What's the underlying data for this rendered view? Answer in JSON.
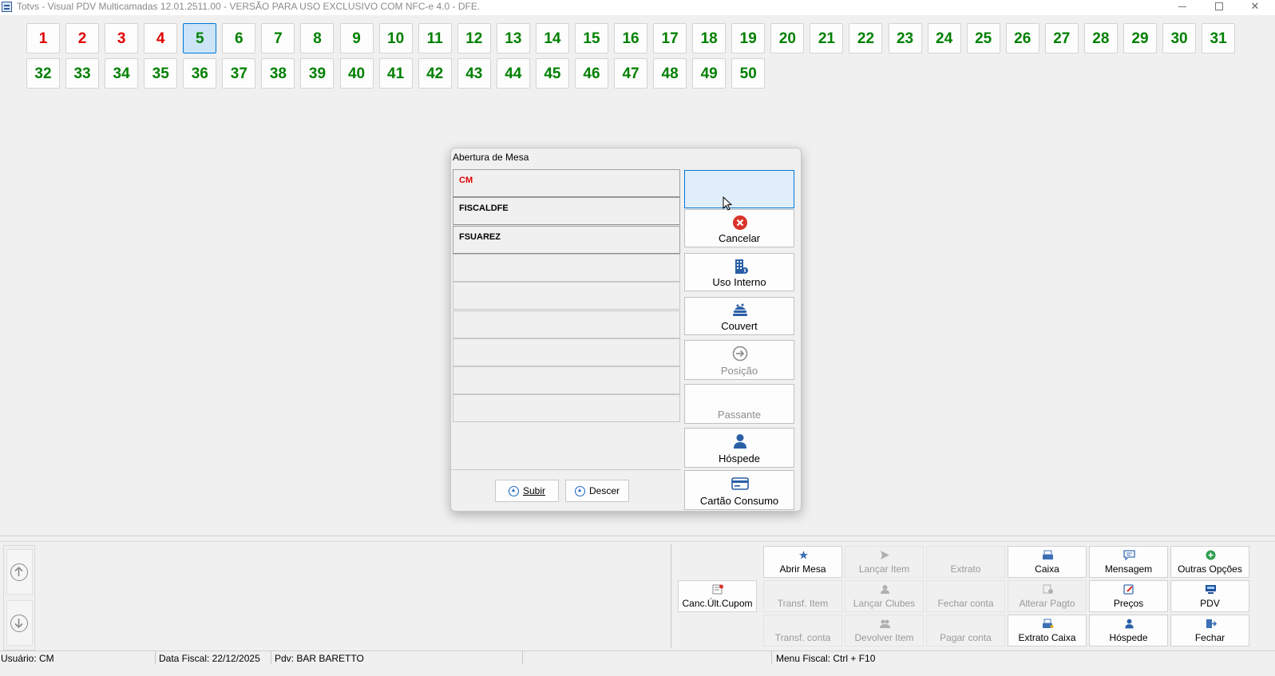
{
  "window": {
    "title": "Totvs - Visual PDV Multicamadas 12.01.2511.00 - VERSÃO PARA USO EXCLUSIVO COM NFC-e 4.0 - DFE."
  },
  "tables": [
    {
      "n": "1",
      "color": "red"
    },
    {
      "n": "2",
      "color": "red"
    },
    {
      "n": "3",
      "color": "red"
    },
    {
      "n": "4",
      "color": "red"
    },
    {
      "n": "5",
      "color": "green",
      "selected": true
    },
    {
      "n": "6",
      "color": "green"
    },
    {
      "n": "7",
      "color": "green"
    },
    {
      "n": "8",
      "color": "green"
    },
    {
      "n": "9",
      "color": "green"
    },
    {
      "n": "10",
      "color": "green"
    },
    {
      "n": "11",
      "color": "green"
    },
    {
      "n": "12",
      "color": "green"
    },
    {
      "n": "13",
      "color": "green"
    },
    {
      "n": "14",
      "color": "green"
    },
    {
      "n": "15",
      "color": "green"
    },
    {
      "n": "16",
      "color": "green"
    },
    {
      "n": "17",
      "color": "green"
    },
    {
      "n": "18",
      "color": "green"
    },
    {
      "n": "19",
      "color": "green"
    },
    {
      "n": "20",
      "color": "green"
    },
    {
      "n": "21",
      "color": "green"
    },
    {
      "n": "22",
      "color": "green"
    },
    {
      "n": "23",
      "color": "green"
    },
    {
      "n": "24",
      "color": "green"
    },
    {
      "n": "25",
      "color": "green"
    },
    {
      "n": "26",
      "color": "green"
    },
    {
      "n": "27",
      "color": "green"
    },
    {
      "n": "28",
      "color": "green"
    },
    {
      "n": "29",
      "color": "green"
    },
    {
      "n": "30",
      "color": "green"
    },
    {
      "n": "31",
      "color": "green"
    },
    {
      "n": "32",
      "color": "green"
    },
    {
      "n": "33",
      "color": "green"
    },
    {
      "n": "34",
      "color": "green"
    },
    {
      "n": "35",
      "color": "green"
    },
    {
      "n": "36",
      "color": "green"
    },
    {
      "n": "37",
      "color": "green"
    },
    {
      "n": "38",
      "color": "green"
    },
    {
      "n": "39",
      "color": "green"
    },
    {
      "n": "40",
      "color": "green"
    },
    {
      "n": "41",
      "color": "green"
    },
    {
      "n": "42",
      "color": "green"
    },
    {
      "n": "43",
      "color": "green"
    },
    {
      "n": "44",
      "color": "green"
    },
    {
      "n": "45",
      "color": "green"
    },
    {
      "n": "46",
      "color": "green"
    },
    {
      "n": "47",
      "color": "green"
    },
    {
      "n": "48",
      "color": "green"
    },
    {
      "n": "49",
      "color": "green"
    },
    {
      "n": "50",
      "color": "green"
    }
  ],
  "dialog": {
    "title": "Abertura de Mesa",
    "users": [
      "CM",
      "FISCALDFE",
      "FSUAREZ",
      "",
      "",
      "",
      "",
      "",
      ""
    ],
    "subir_label": "Subir",
    "descer_label": "Descer",
    "buttons": [
      {
        "label": "",
        "icon": "blank",
        "disabled": false
      },
      {
        "label": "Cancelar",
        "icon": "cancel-icon",
        "disabled": false
      },
      {
        "label": "Uso Interno",
        "icon": "building-icon",
        "disabled": false
      },
      {
        "label": "Couvert",
        "icon": "food-tray-icon",
        "disabled": false
      },
      {
        "label": "Posição",
        "icon": "arrow-circle-icon",
        "disabled": true
      },
      {
        "label": "Passante",
        "icon": "blank",
        "disabled": true
      },
      {
        "label": "Hóspede",
        "icon": "person-icon",
        "disabled": false
      },
      {
        "label": "Cartão Consumo",
        "icon": "card-icon",
        "disabled": false
      }
    ]
  },
  "functions": {
    "canc_ult_cupom": "Canc.Últ.Cupom",
    "rows": [
      [
        {
          "label": "Abrir Mesa",
          "icon": "open-table-icon",
          "disabled": false
        },
        {
          "label": "Lançar Item",
          "icon": "send-icon",
          "disabled": true
        },
        {
          "label": "Extrato",
          "icon": "blank",
          "disabled": true
        },
        {
          "label": "Caixa",
          "icon": "register-icon",
          "disabled": false
        },
        {
          "label": "Mensagem",
          "icon": "message-icon",
          "disabled": false
        },
        {
          "label": "Outras Opções",
          "icon": "plus-circle-icon",
          "disabled": false
        }
      ],
      [
        {
          "label": "Transf. Item",
          "icon": "blank",
          "disabled": true
        },
        {
          "label": "Lançar Clubes",
          "icon": "club-icon",
          "disabled": true
        },
        {
          "label": "Fechar conta",
          "icon": "blank",
          "disabled": true
        },
        {
          "label": "Alterar Pagto",
          "icon": "payment-change-icon",
          "disabled": true
        },
        {
          "label": "Preços",
          "icon": "price-icon",
          "disabled": false
        },
        {
          "label": "PDV",
          "icon": "pdv-icon",
          "disabled": false
        }
      ],
      [
        {
          "label": "Transf. conta",
          "icon": "blank",
          "disabled": true
        },
        {
          "label": "Devolver Item",
          "icon": "return-icon",
          "disabled": true
        },
        {
          "label": "Pagar conta",
          "icon": "blank",
          "disabled": true
        },
        {
          "label": "Extrato Caixa",
          "icon": "register-statement-icon",
          "disabled": false
        },
        {
          "label": "Hóspede",
          "icon": "person-icon",
          "disabled": false
        },
        {
          "label": "Fechar",
          "icon": "exit-icon",
          "disabled": false
        }
      ]
    ]
  },
  "status": {
    "usuario": "Usuário: CM",
    "data_fiscal": "Data Fiscal: 22/12/2025",
    "pdv": "Pdv: BAR BARETTO",
    "menu_fiscal": "Menu Fiscal: Ctrl + F10"
  },
  "colors": {
    "open_table": "#008000",
    "occupied_table": "#e00000",
    "selected_bg": "#cce4f7",
    "accent": "#0078d7"
  }
}
